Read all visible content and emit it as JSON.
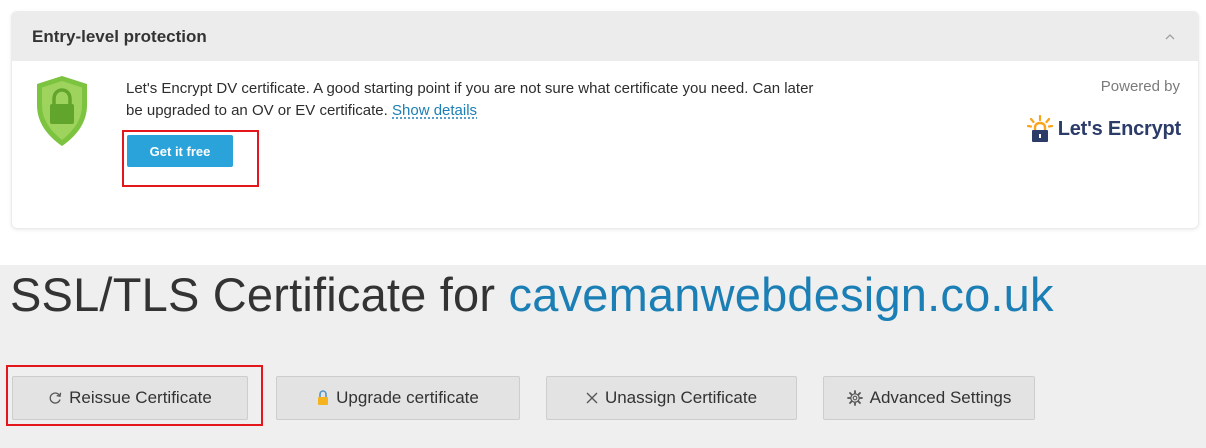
{
  "card": {
    "title": "Entry-level protection",
    "description": "Let's Encrypt DV certificate. A good starting point if you are not sure what certificate you need. Can later be upgraded to an OV or EV certificate.",
    "show_details": "Show details",
    "get_free": "Get it free",
    "powered_by": "Powered by",
    "brand": "Let's Encrypt"
  },
  "page": {
    "title_prefix": "SSL/TLS Certificate for",
    "domain": "cavemanwebdesign.co.uk"
  },
  "actions": [
    {
      "label": "Reissue Certificate",
      "icon": "refresh-icon"
    },
    {
      "label": "Upgrade certificate",
      "icon": "lock-icon"
    },
    {
      "label": "Unassign Certificate",
      "icon": "close-icon"
    },
    {
      "label": "Advanced Settings",
      "icon": "gear-icon"
    }
  ],
  "colors": {
    "accent": "#1b7fb5",
    "primary_button": "#29a3d9",
    "shield_green": "#7cc33f",
    "highlight_red": "#e2161b",
    "brand_navy": "#2c3c69",
    "brand_yellow": "#f8a51b"
  }
}
